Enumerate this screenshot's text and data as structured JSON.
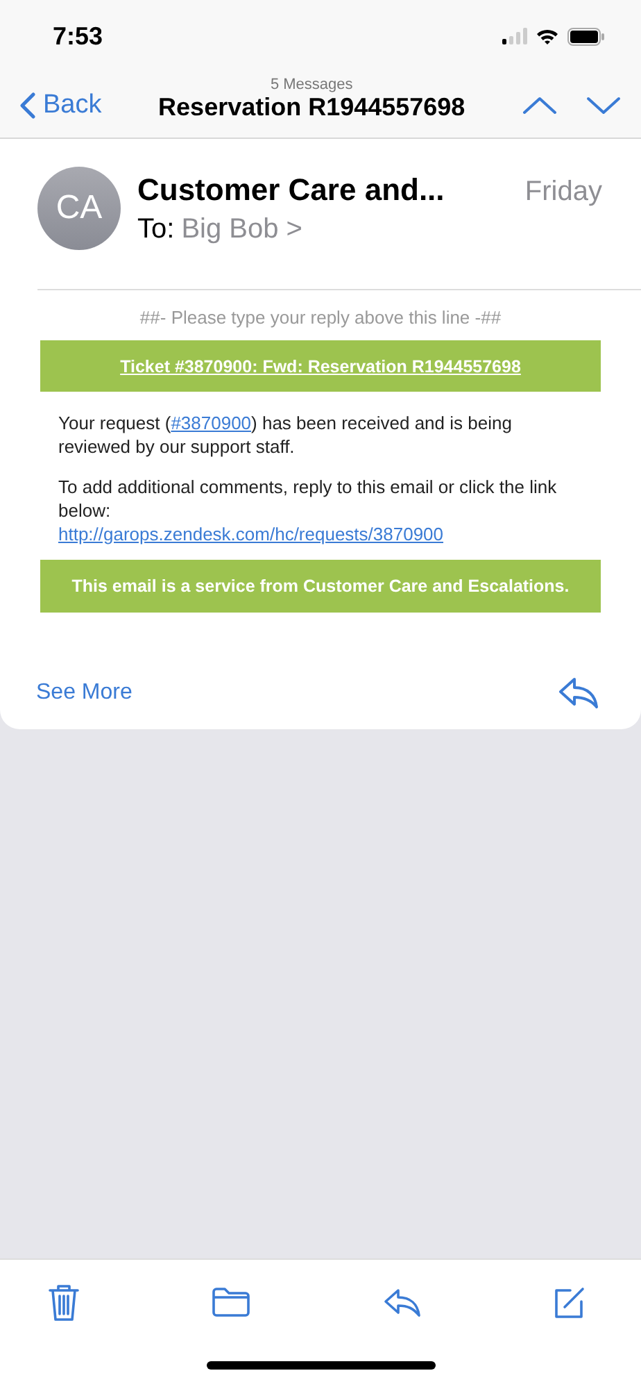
{
  "status_bar": {
    "time": "7:53"
  },
  "nav": {
    "back": "Back",
    "subtitle": "5 Messages",
    "title": "Reservation R1944557698"
  },
  "message": {
    "avatar": "CA",
    "sender": "Customer Care and...",
    "date": "Friday",
    "to_label": "To:",
    "recipient": "Big Bob",
    "recipient_chevron": ">",
    "reply_hint": "##- Please type your reply above this line -##",
    "ticket_banner": "Ticket #3870900: Fwd: Reservation R1944557698",
    "paragraph_1": {
      "before": "Your request (",
      "link": "#3870900",
      "after": ") has been received and is being reviewed by our support staff."
    },
    "paragraph_2": "To add additional comments, reply to this email or click the link below:",
    "request_link": "http://garops.zendesk.com/hc/requests/3870900",
    "footer_banner": "This email is a service from Customer Care and Escalations.",
    "see_more": "See More"
  }
}
